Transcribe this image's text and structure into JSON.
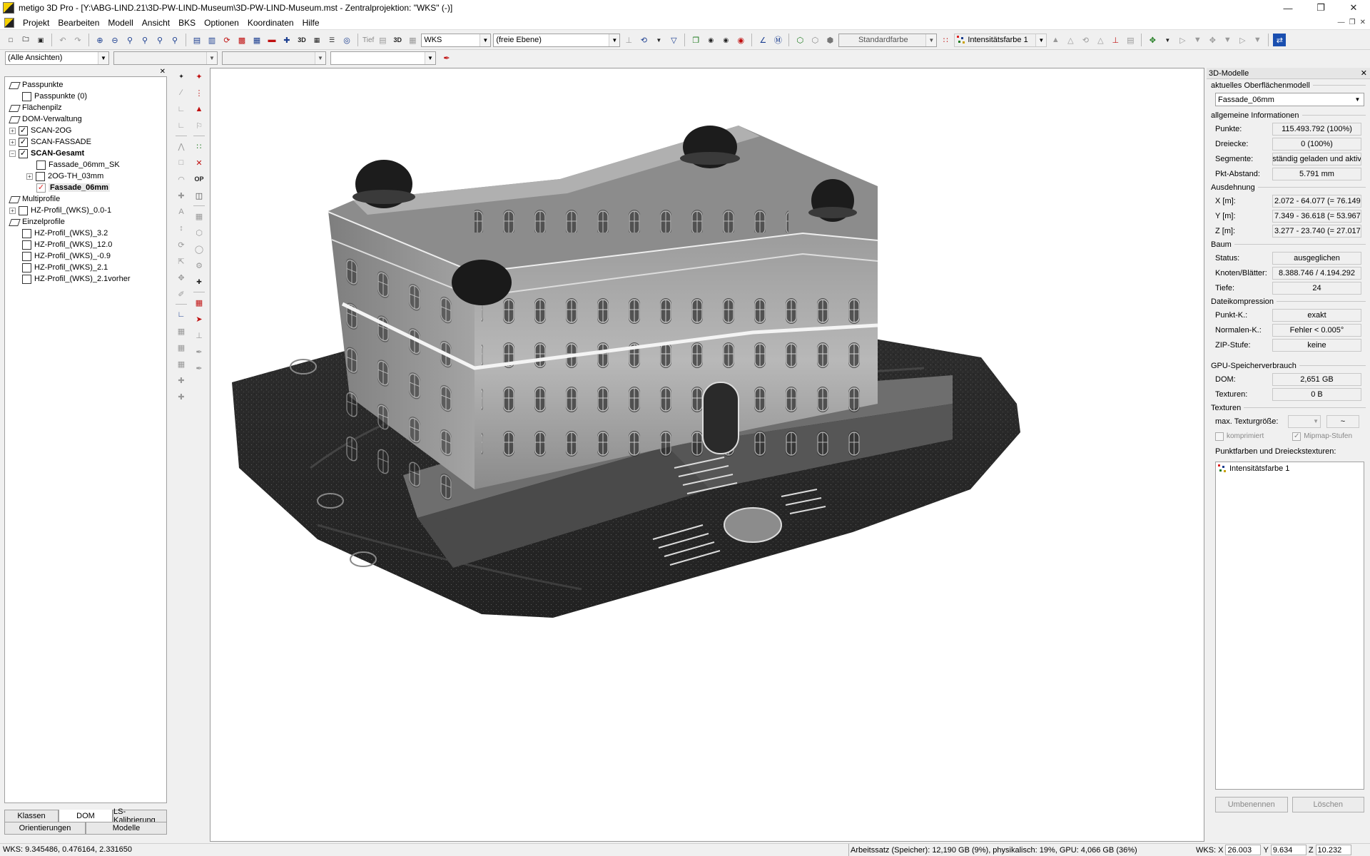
{
  "window": {
    "title": "metigo 3D Pro - [Y:\\ABG-LIND.21\\3D-PW-LIND-Museum\\3D-PW-LIND-Museum.mst - Zentralprojektion: \"WKS\" (-)]"
  },
  "menu": [
    "Projekt",
    "Bearbeiten",
    "Modell",
    "Ansicht",
    "BKS",
    "Optionen",
    "Koordinaten",
    "Hilfe"
  ],
  "toolbar": {
    "tief_label": "Tief",
    "view3d_label": "3D",
    "coord_system": "WKS",
    "plane": "(freie Ebene)",
    "default_color": "Standardfarbe",
    "intensity_color": "Intensitätsfarbe 1"
  },
  "toolbar2": {
    "views": "(Alle Ansichten)"
  },
  "tree": {
    "items": [
      {
        "label": "Passpunkte"
      },
      {
        "label": "Passpunkte (0)"
      },
      {
        "label": "Flächenpilz"
      },
      {
        "label": "DOM-Verwaltung"
      },
      {
        "label": "SCAN-2OG"
      },
      {
        "label": "SCAN-FASSADE"
      },
      {
        "label": "SCAN-Gesamt"
      },
      {
        "label": "Fassade_06mm_SK"
      },
      {
        "label": "2OG-TH_03mm"
      },
      {
        "label": "Fassade_06mm"
      },
      {
        "label": "Multiprofile"
      },
      {
        "label": "HZ-Profil_(WKS)_0.0-1"
      },
      {
        "label": "Einzelprofile"
      },
      {
        "label": "HZ-Profil_(WKS)_3.2"
      },
      {
        "label": "HZ-Profil_(WKS)_12.0"
      },
      {
        "label": "HZ-Profil_(WKS)_-0.9"
      },
      {
        "label": "HZ-Profil_(WKS)_2.1"
      },
      {
        "label": "HZ-Profil_(WKS)_2.1vorher"
      }
    ]
  },
  "tabs": {
    "row1": [
      "Klassen",
      "DOM",
      "LS-Kalibrierung"
    ],
    "row2": [
      "Orientierungen",
      "Modelle"
    ]
  },
  "vstrip": {
    "op_label": "OP"
  },
  "right_panel": {
    "title": "3D-Modelle",
    "current_model_group": "aktuelles Oberflächenmodell",
    "current_model": "Fassade_06mm",
    "general_group": "allgemeine Informationen",
    "punkte_label": "Punkte:",
    "punkte": "115.493.792 (100%)",
    "dreiecke_label": "Dreiecke:",
    "dreiecke": "0 (100%)",
    "segmente_label": "Segmente:",
    "segmente": "ständig geladen und aktiv",
    "pkt_abstand_label": "Pkt-Abstand:",
    "pkt_abstand": "5.791 mm",
    "extent_group": "Ausdehnung",
    "x_label": "X [m]:",
    "x": "2.072 - 64.077 (= 76.149",
    "y_label": "Y [m]:",
    "y": "7.349 - 36.618 (= 53.967",
    "z_label": "Z [m]:",
    "z": "3.277 - 23.740 (= 27.017",
    "tree_group": "Baum",
    "status_label": "Status:",
    "status": "ausgeglichen",
    "knoten_label": "Knoten/Blätter:",
    "knoten": "8.388.746 / 4.194.292",
    "tiefe_label": "Tiefe:",
    "tiefe": "24",
    "compression_group": "Dateikompression",
    "punkt_k_label": "Punkt-K.:",
    "punkt_k": "exakt",
    "normalen_k_label": "Normalen-K.:",
    "normalen_k": "Fehler < 0.005°",
    "zip_label": "ZIP-Stufe:",
    "zip": "keine",
    "gpu_group": "GPU-Speicherverbrauch",
    "dom_label": "DOM:",
    "dom": "2,651 GB",
    "texturen_label": "Texturen:",
    "texturen": "0 B",
    "textures_group": "Texturen",
    "max_tex_label": "max. Texturgröße:",
    "max_tex_extra": "~",
    "komprimiert": "komprimiert",
    "mipmap": "Mipmap-Stufen",
    "colors_label": "Punktfarben und Dreieckstexturen:",
    "color_item": "Intensitätsfarbe 1",
    "rename_btn": "Umbenennen",
    "delete_btn": "Löschen"
  },
  "statusbar": {
    "wks": "WKS: 9.345486, 0.476164, 2.331650",
    "memory": "Arbeitssatz (Speicher): 12,190 GB (9%), physikalisch: 19%, GPU: 4,066 GB (36%)",
    "coord_label": "WKS:",
    "x_label": "X",
    "x": "26.003",
    "y_label": "Y",
    "y": "9.634",
    "z_label": "Z",
    "z": "10.232"
  },
  "colors": {
    "accent_red": "#c01010",
    "accent_blue": "#1a3d8f"
  }
}
